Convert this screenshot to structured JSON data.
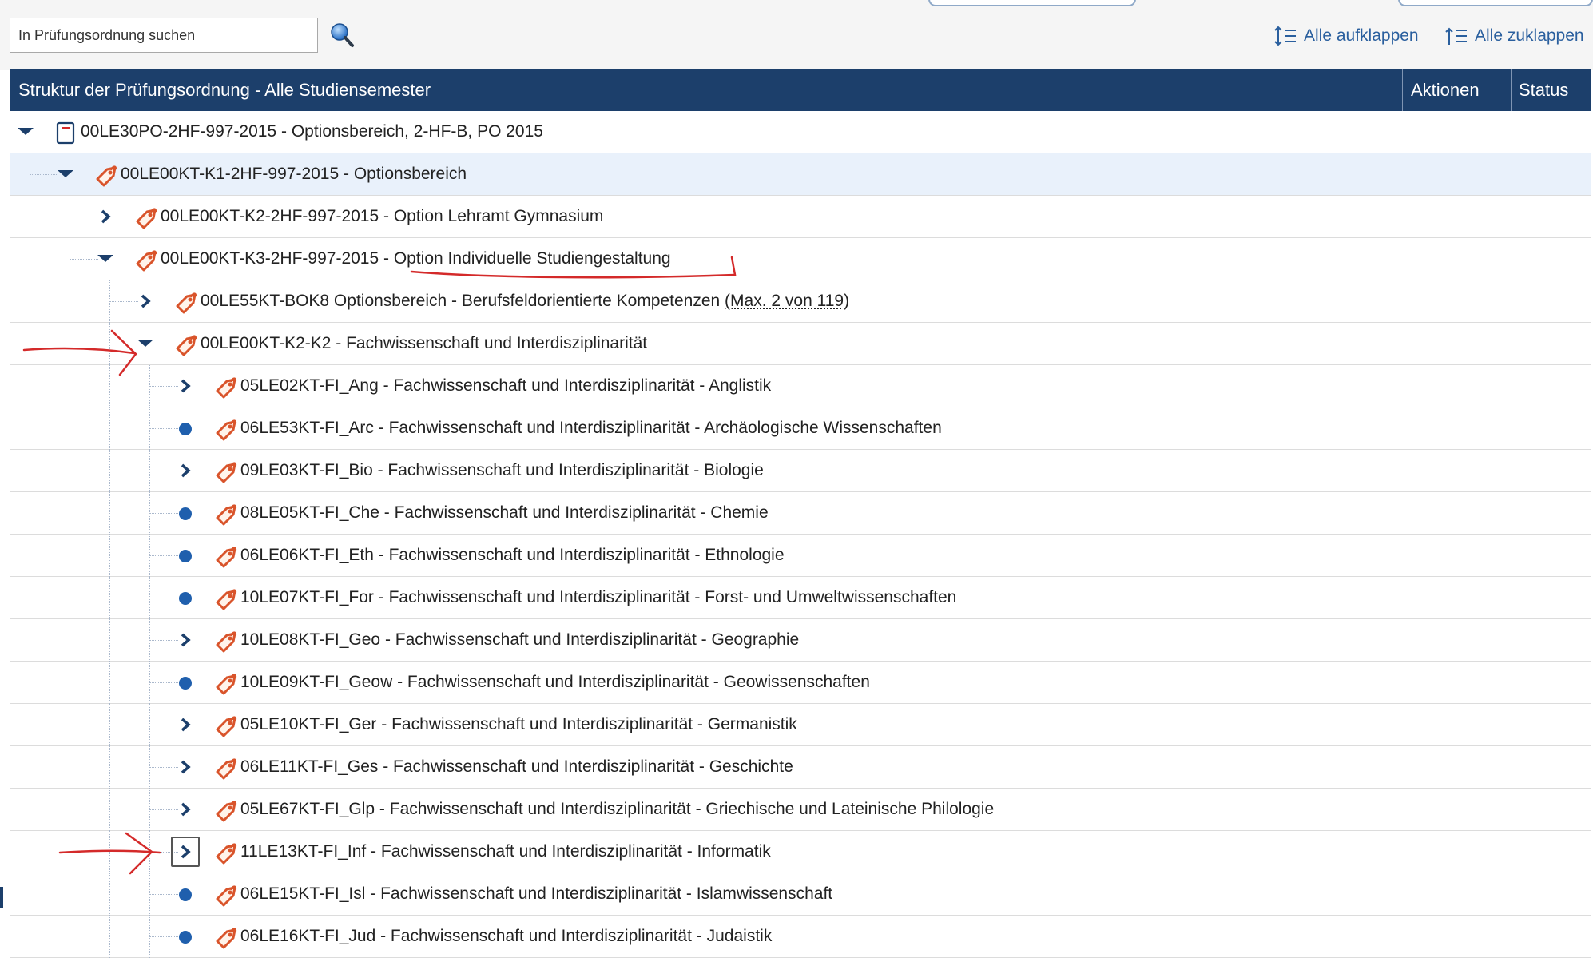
{
  "toolbar": {
    "search_placeholder": "In Prüfungsordnung suchen",
    "expand_all": "Alle aufklappen",
    "collapse_all": "Alle zuklappen"
  },
  "table": {
    "header_title": "Struktur der Prüfungsordnung - Alle Studiensemester",
    "header_actions": "Aktionen",
    "header_status": "Status"
  },
  "tree_rows": [
    {
      "level": 0,
      "toggle": "expanded",
      "icon": "document-icon",
      "label": "00LE30PO-2HF-997-2015 - Optionsbereich, 2-HF-B, PO 2015"
    },
    {
      "level": 1,
      "toggle": "expanded",
      "icon": "tag-icon",
      "label": "00LE00KT-K1-2HF-997-2015 - Optionsbereich",
      "highlighted": true
    },
    {
      "level": 2,
      "toggle": "collapsed",
      "icon": "tag-icon",
      "label": "00LE00KT-K2-2HF-997-2015 - Option Lehramt Gymnasium"
    },
    {
      "level": 2,
      "toggle": "expanded",
      "icon": "tag-icon",
      "label": "00LE00KT-K3-2HF-997-2015 - Option Individuelle Studiengestaltung"
    },
    {
      "level": 3,
      "toggle": "collapsed",
      "icon": "tag-icon",
      "label": "00LE55KT-BOK8 Optionsbereich - Berufsfeldorientierte Kompetenzen",
      "extra": "(Max. 2 von 119)"
    },
    {
      "level": 3,
      "toggle": "expanded",
      "icon": "tag-icon",
      "label": "00LE00KT-K2-K2 - Fachwissenschaft und Interdisziplinarität"
    },
    {
      "level": 4,
      "toggle": "collapsed",
      "icon": "tag-icon",
      "label": "05LE02KT-FI_Ang - Fachwissenschaft und Interdisziplinarität - Anglistik"
    },
    {
      "level": 4,
      "toggle": "leaf",
      "icon": "tag-icon",
      "label": "06LE53KT-FI_Arc - Fachwissenschaft und Interdisziplinarität - Archäologische Wissenschaften"
    },
    {
      "level": 4,
      "toggle": "collapsed",
      "icon": "tag-icon",
      "label": "09LE03KT-FI_Bio - Fachwissenschaft und Interdisziplinarität - Biologie"
    },
    {
      "level": 4,
      "toggle": "leaf",
      "icon": "tag-icon",
      "label": "08LE05KT-FI_Che - Fachwissenschaft und Interdisziplinarität - Chemie"
    },
    {
      "level": 4,
      "toggle": "leaf",
      "icon": "tag-icon",
      "label": "06LE06KT-FI_Eth - Fachwissenschaft und Interdisziplinarität - Ethnologie"
    },
    {
      "level": 4,
      "toggle": "leaf",
      "icon": "tag-icon",
      "label": "10LE07KT-FI_For - Fachwissenschaft und Interdisziplinarität - Forst- und Umweltwissenschaften"
    },
    {
      "level": 4,
      "toggle": "collapsed",
      "icon": "tag-icon",
      "label": "10LE08KT-FI_Geo - Fachwissenschaft und Interdisziplinarität - Geographie"
    },
    {
      "level": 4,
      "toggle": "leaf",
      "icon": "tag-icon",
      "label": "10LE09KT-FI_Geow - Fachwissenschaft und Interdisziplinarität - Geowissenschaften"
    },
    {
      "level": 4,
      "toggle": "collapsed",
      "icon": "tag-icon",
      "label": "05LE10KT-FI_Ger - Fachwissenschaft und Interdisziplinarität - Germanistik"
    },
    {
      "level": 4,
      "toggle": "collapsed",
      "icon": "tag-icon",
      "label": "06LE11KT-FI_Ges - Fachwissenschaft und Interdisziplinarität - Geschichte"
    },
    {
      "level": 4,
      "toggle": "collapsed",
      "icon": "tag-icon",
      "label": "05LE67KT-FI_Glp - Fachwissenschaft und Interdisziplinarität - Griechische und Lateinische Philologie"
    },
    {
      "level": 4,
      "toggle": "collapsed",
      "icon": "tag-icon",
      "label": "11LE13KT-FI_Inf - Fachwissenschaft und Interdisziplinarität - Informatik",
      "focused": true
    },
    {
      "level": 4,
      "toggle": "leaf",
      "icon": "tag-icon",
      "label": "06LE15KT-FI_Isl - Fachwissenschaft und Interdisziplinarität - Islamwissenschaft"
    },
    {
      "level": 4,
      "toggle": "leaf",
      "icon": "tag-icon",
      "label": "06LE16KT-FI_Jud - Fachwissenschaft und Interdisziplinarität - Judaistik"
    }
  ],
  "colors": {
    "header_bg": "#1c3f6b",
    "link": "#2a5f9e",
    "tag_icon": "#d9542b",
    "bullet": "#1f5fad",
    "annotation": "#d42a2a"
  }
}
